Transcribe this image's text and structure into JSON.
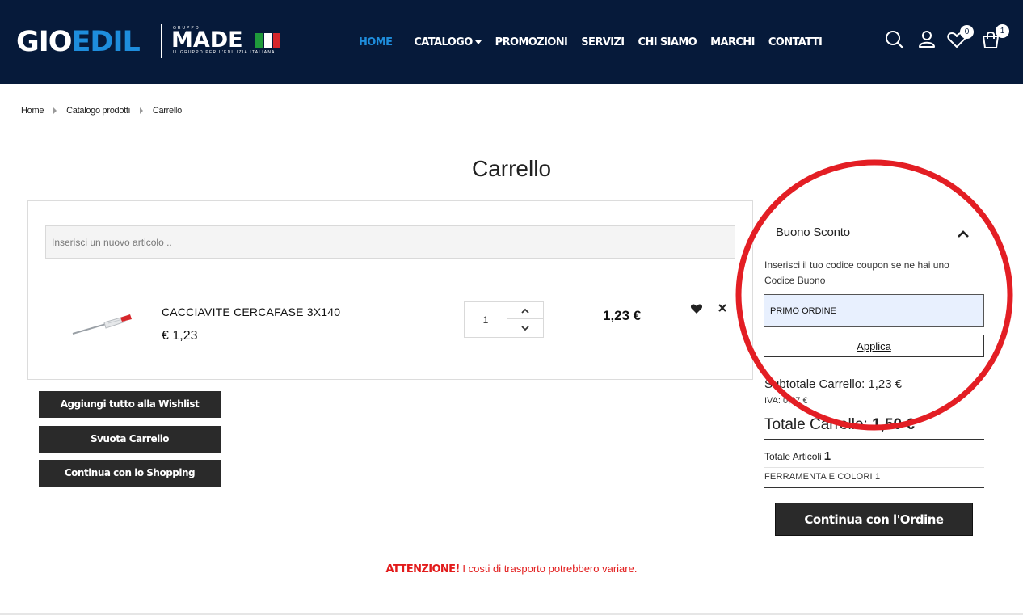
{
  "header": {
    "logo_gio": "GIO",
    "logo_edil": "EDIL",
    "logo_gruppo": "GRUPPO",
    "logo_made": "MADE",
    "logo_tagline": "IL GRUPPO PER L'EDILIZIA ITALIANA",
    "flag_colors": [
      "#1f9a3b",
      "#ffffff",
      "#d7262b"
    ],
    "nav": [
      {
        "label": "HOME",
        "active": true
      },
      {
        "label": "CATALOGO",
        "dropdown": true
      },
      {
        "label": "PROMOZIONI"
      },
      {
        "label": "SERVIZI"
      },
      {
        "label": "CHI SIAMO"
      },
      {
        "label": "MARCHI"
      },
      {
        "label": "CONTATTI"
      }
    ],
    "icons": [
      "search-icon",
      "user-icon",
      "heart-icon",
      "cart-icon"
    ],
    "wishlist_count": "0",
    "cart_count": "1",
    "colors": {
      "background": "#061a3a",
      "accent": "#1e8ddc"
    }
  },
  "breadcrumb": [
    "Home",
    "Catalogo prodotti",
    "Carrello"
  ],
  "page_title": "Carrello",
  "cart": {
    "add_placeholder": "Inserisci un nuovo articolo ..",
    "items": [
      {
        "name": "CACCIAVITE CERCAFASE 3X140",
        "price": "€ 1,23",
        "quantity": "1",
        "total": "1,23 €"
      }
    ]
  },
  "actions": {
    "wishlist_all": "Aggiungi tutto alla Wishlist",
    "empty_cart": "Svuota Carrello",
    "continue_shopping": "Continua con lo Shopping"
  },
  "coupon": {
    "title": "Buono Sconto",
    "help": "Inserisci il tuo codice coupon se ne hai uno",
    "label": "Codice Buono",
    "value": "PRIMO ORDINE",
    "apply": "Applica"
  },
  "summary": {
    "subtotal_label": "Subtotale Carrello:",
    "subtotal_value": "1,23 €",
    "iva_label": "IVA:",
    "iva_value": "0,27 €",
    "total_label": "Totale Carrello:",
    "total_value": "1,50 €",
    "articles_label": "Totale Articoli",
    "articles_value": "1",
    "category": "FERRAMENTA E COLORI 1",
    "order_button": "Continua con l'Ordine"
  },
  "warning": {
    "strong": "ATTENZIONE!",
    "text": " I costi di trasporto potrebbero variare.",
    "color": "#e21b1b"
  },
  "annotation_color": "#e31e24"
}
